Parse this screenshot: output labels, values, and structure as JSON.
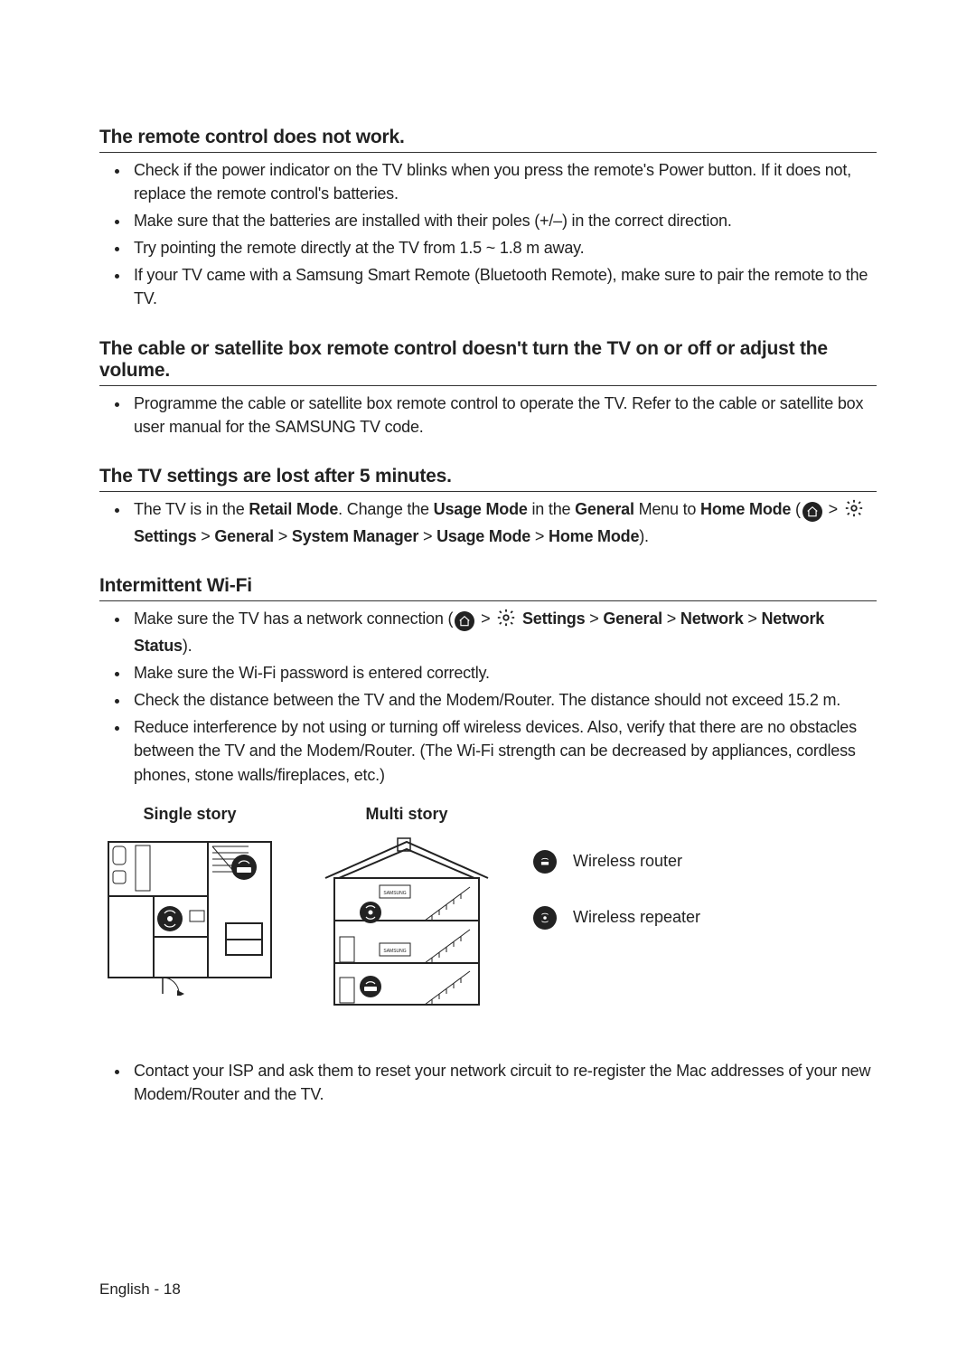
{
  "sections": [
    {
      "heading": "The remote control does not work.",
      "items": [
        {
          "text": "Check if the power indicator on the TV blinks when you press the remote's Power button. If it does not, replace the remote control's batteries."
        },
        {
          "text": "Make sure that the batteries are installed with their poles (+/–) in the correct direction."
        },
        {
          "text": "Try pointing the remote directly at the TV from 1.5 ~ 1.8 m away."
        },
        {
          "text": "If your TV came with a Samsung Smart Remote (Bluetooth Remote), make sure to pair the remote to the TV."
        }
      ]
    },
    {
      "heading": "The cable or satellite box remote control doesn't turn the TV on or off or adjust the volume.",
      "items": [
        {
          "text": "Programme the cable or satellite box remote control to operate the TV. Refer to the cable or satellite box user manual for the SAMSUNG TV code."
        }
      ]
    },
    {
      "heading": "The TV settings are lost after 5 minutes.",
      "items": [
        {
          "parts": [
            {
              "t": "The TV is in the "
            },
            {
              "t": "Retail Mode",
              "b": true
            },
            {
              "t": ". Change the "
            },
            {
              "t": "Usage Mode",
              "b": true
            },
            {
              "t": " in the "
            },
            {
              "t": "General",
              "b": true
            },
            {
              "t": " Menu to "
            },
            {
              "t": "Home Mode",
              "b": true
            },
            {
              "t": " ("
            },
            {
              "icon": "home"
            },
            {
              "t": " > "
            },
            {
              "icon": "gear"
            },
            {
              "t": " "
            },
            {
              "t": "Settings",
              "b": true
            },
            {
              "t": " > "
            },
            {
              "t": "General",
              "b": true
            },
            {
              "t": " > "
            },
            {
              "t": "System Manager",
              "b": true
            },
            {
              "t": " > "
            },
            {
              "t": "Usage Mode",
              "b": true
            },
            {
              "t": " > "
            },
            {
              "t": "Home Mode",
              "b": true
            },
            {
              "t": ")."
            }
          ]
        }
      ]
    },
    {
      "heading": "Intermittent Wi-Fi",
      "items": [
        {
          "parts": [
            {
              "t": "Make sure the TV has a network connection ("
            },
            {
              "icon": "home"
            },
            {
              "t": " > "
            },
            {
              "icon": "gear"
            },
            {
              "t": " "
            },
            {
              "t": "Settings",
              "b": true
            },
            {
              "t": " > "
            },
            {
              "t": "General",
              "b": true
            },
            {
              "t": " > "
            },
            {
              "t": "Network",
              "b": true
            },
            {
              "t": " > "
            },
            {
              "t": "Network Status",
              "b": true
            },
            {
              "t": ")."
            }
          ]
        },
        {
          "text": "Make sure the Wi-Fi password is entered correctly."
        },
        {
          "text": "Check the distance between the TV and the Modem/Router. The distance should not exceed 15.2 m."
        },
        {
          "text": "Reduce interference by not using or turning off wireless devices. Also, verify that there are no obstacles between the TV and the Modem/Router. (The Wi-Fi strength can be decreased by appliances, cordless phones, stone walls/fireplaces, etc.)"
        }
      ],
      "diagram": true,
      "after_items": [
        {
          "text": "Contact your ISP and ask them to reset your network circuit to re-register the Mac addresses of your new Modem/Router and the TV."
        }
      ]
    }
  ],
  "diagram": {
    "single_label": "Single story",
    "multi_label": "Multi story",
    "legend_router": "Wireless router",
    "legend_repeater": "Wireless repeater"
  },
  "footer": {
    "language": "English",
    "page": "18"
  }
}
